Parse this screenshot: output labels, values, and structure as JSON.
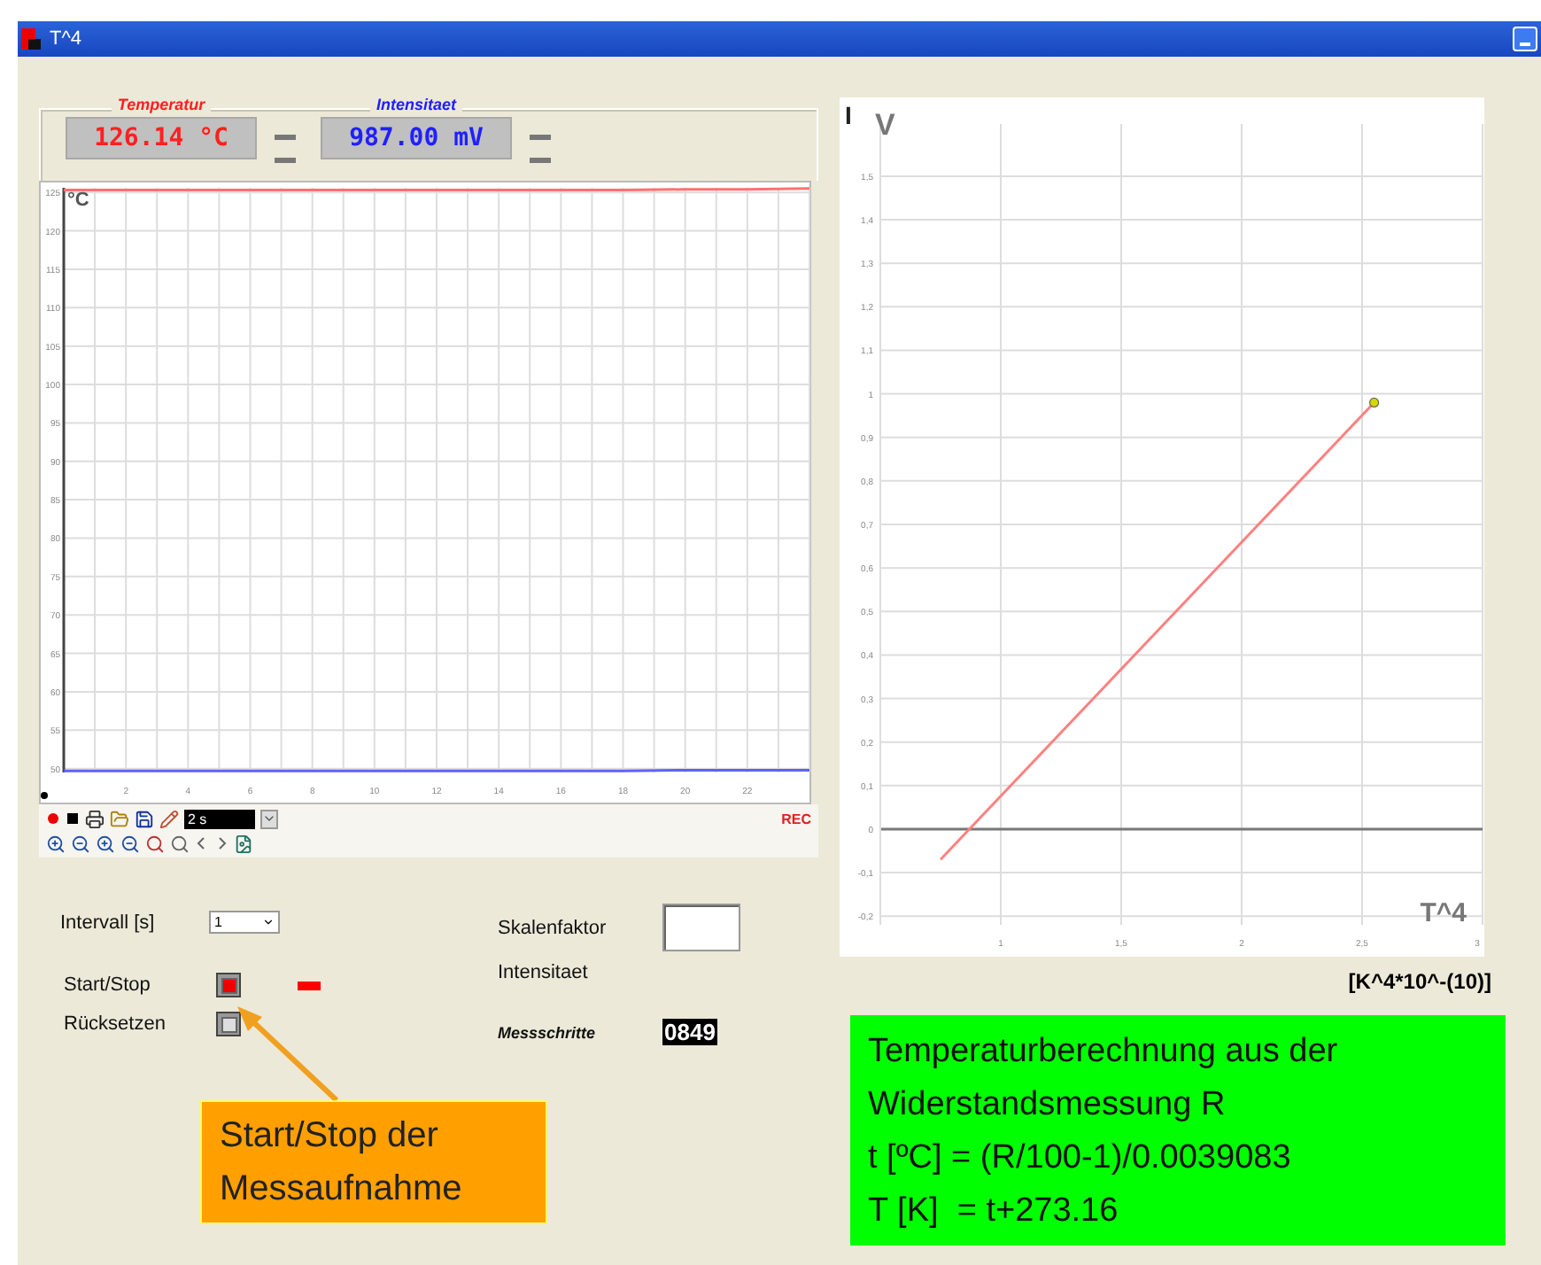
{
  "window": {
    "title": "T^4"
  },
  "readouts": [
    {
      "label": "Temperatur",
      "value": "126.14 °C",
      "color": "#ff2020"
    },
    {
      "label": "Intensitaet",
      "value": "987.00 mV",
      "color": "#2020ff"
    }
  ],
  "time_chart": {
    "chart_data": {
      "type": "line",
      "ylabel": "°C",
      "x": [
        0,
        2,
        4,
        6,
        8,
        10,
        12,
        14,
        16,
        18,
        20,
        22,
        24
      ],
      "grid": true,
      "series": [
        {
          "color": "#ff7070",
          "values": [
            125.3,
            125.3,
            125.3,
            125.3,
            125.3,
            125.3,
            125.3,
            125.3,
            125.3,
            125.3,
            125.4,
            125.4,
            125.5
          ]
        },
        {
          "color": "#6060ff",
          "values": [
            49.7,
            49.7,
            49.7,
            49.7,
            49.7,
            49.7,
            49.7,
            49.7,
            49.7,
            49.7,
            49.8,
            49.8,
            49.8
          ]
        }
      ],
      "xlim": [
        0,
        24
      ],
      "ylim": [
        49.5,
        125.6
      ],
      "xticks": [
        2,
        4,
        6,
        8,
        10,
        12,
        14,
        16,
        18,
        20,
        22
      ],
      "yticks": [
        50,
        55,
        60,
        65,
        70,
        75,
        80,
        85,
        90,
        95,
        100,
        105,
        110,
        115,
        120,
        125
      ]
    }
  },
  "toolbar": {
    "interval": "2 s",
    "rec": "REC"
  },
  "controls": {
    "interval": {
      "label": "Intervall [s]",
      "value": "1"
    },
    "scale": {
      "label": "Skalenfaktor"
    },
    "intensity_label": "Intensitaet",
    "start_stop": {
      "label": "Start/Stop",
      "on": true
    },
    "reset": {
      "label": "Rücksetzen"
    },
    "steps": {
      "label": "Messschritte",
      "value": "0849"
    }
  },
  "xy_chart": {
    "corner_label": "I",
    "chart_data": {
      "type": "line",
      "ylabel": "V",
      "xlabel": "T^4",
      "x": [
        0.75,
        2.55
      ],
      "grid": true,
      "series": [
        {
          "color": "#ff8080",
          "values": [
            -0.07,
            0.98
          ]
        }
      ],
      "xlim": [
        0.5,
        3
      ],
      "ylim": [
        -0.22,
        1.62
      ],
      "xticks": [
        {
          "value": 1,
          "label": "1"
        },
        {
          "value": 1.5,
          "label": "1,5"
        },
        {
          "value": 2,
          "label": "2"
        },
        {
          "value": 2.5,
          "label": "2,5"
        },
        {
          "value": 3,
          "label": "3"
        }
      ],
      "yticks": [
        {
          "value": -0.2,
          "label": "-0,2"
        },
        {
          "value": -0.1,
          "label": "-0,1"
        },
        {
          "value": 0,
          "label": "0"
        },
        {
          "value": 0.1,
          "label": "0,1"
        },
        {
          "value": 0.2,
          "label": "0,2"
        },
        {
          "value": 0.3,
          "label": "0,3"
        },
        {
          "value": 0.4,
          "label": "0,4"
        },
        {
          "value": 0.5,
          "label": "0,5"
        },
        {
          "value": 0.6,
          "label": "0,6"
        },
        {
          "value": 0.7,
          "label": "0,7"
        },
        {
          "value": 0.8,
          "label": "0,8"
        },
        {
          "value": 0.9,
          "label": "0,9"
        },
        {
          "value": 1,
          "label": "1"
        },
        {
          "value": 1.1,
          "label": "1,1"
        },
        {
          "value": 1.2,
          "label": "1,2"
        },
        {
          "value": 1.3,
          "label": "1,3"
        },
        {
          "value": 1.4,
          "label": "1,4"
        },
        {
          "value": 1.5,
          "label": "1,5"
        }
      ]
    }
  },
  "unit_label": "[K^4*10^-(10)]",
  "callout": {
    "text": "Start/Stop der Messaufnahme"
  },
  "formula_box": {
    "lines": [
      "Temperaturberechnung aus der",
      "Widerstandsmessung R",
      "t [ºC] = (R/100-1)/0.0039083",
      "T [K]  = t+273.16"
    ]
  }
}
